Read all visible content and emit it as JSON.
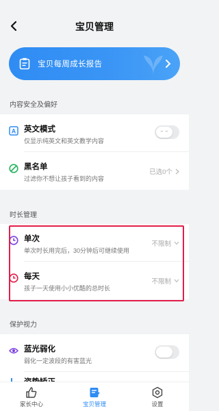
{
  "header": {
    "title": "宝贝管理"
  },
  "banner": {
    "label": "宝贝每周成长报告"
  },
  "sections": {
    "content_safety": "内容安全及偏好",
    "duration": "时长管理",
    "eye_protection": "保护视力"
  },
  "content_safety": {
    "english_mode": {
      "title": "英文模式",
      "desc": "仅显示纯英文和英文教学内容"
    },
    "blacklist": {
      "title": "黑名单",
      "desc": "过滤你不想让孩子看到的内容",
      "value": "已选0个"
    }
  },
  "duration": {
    "single": {
      "title": "单次",
      "desc": "单次时长用完后，30分钟后可继续使用",
      "value": "不限制"
    },
    "daily": {
      "title": "每天",
      "desc": "孩子一天使用小小优酷的总时长",
      "value": "不限制"
    }
  },
  "eye": {
    "blue_light": {
      "title": "蓝光弱化",
      "desc": "弱化一定波段的有害蓝光"
    },
    "posture": {
      "title": "姿势矫正"
    }
  },
  "nav": {
    "parent_center": "家长中心",
    "baby_manage": "宝贝管理",
    "settings": "设置"
  },
  "colors": {
    "accent": "#2f8cf3",
    "highlight": "#e11d48"
  }
}
